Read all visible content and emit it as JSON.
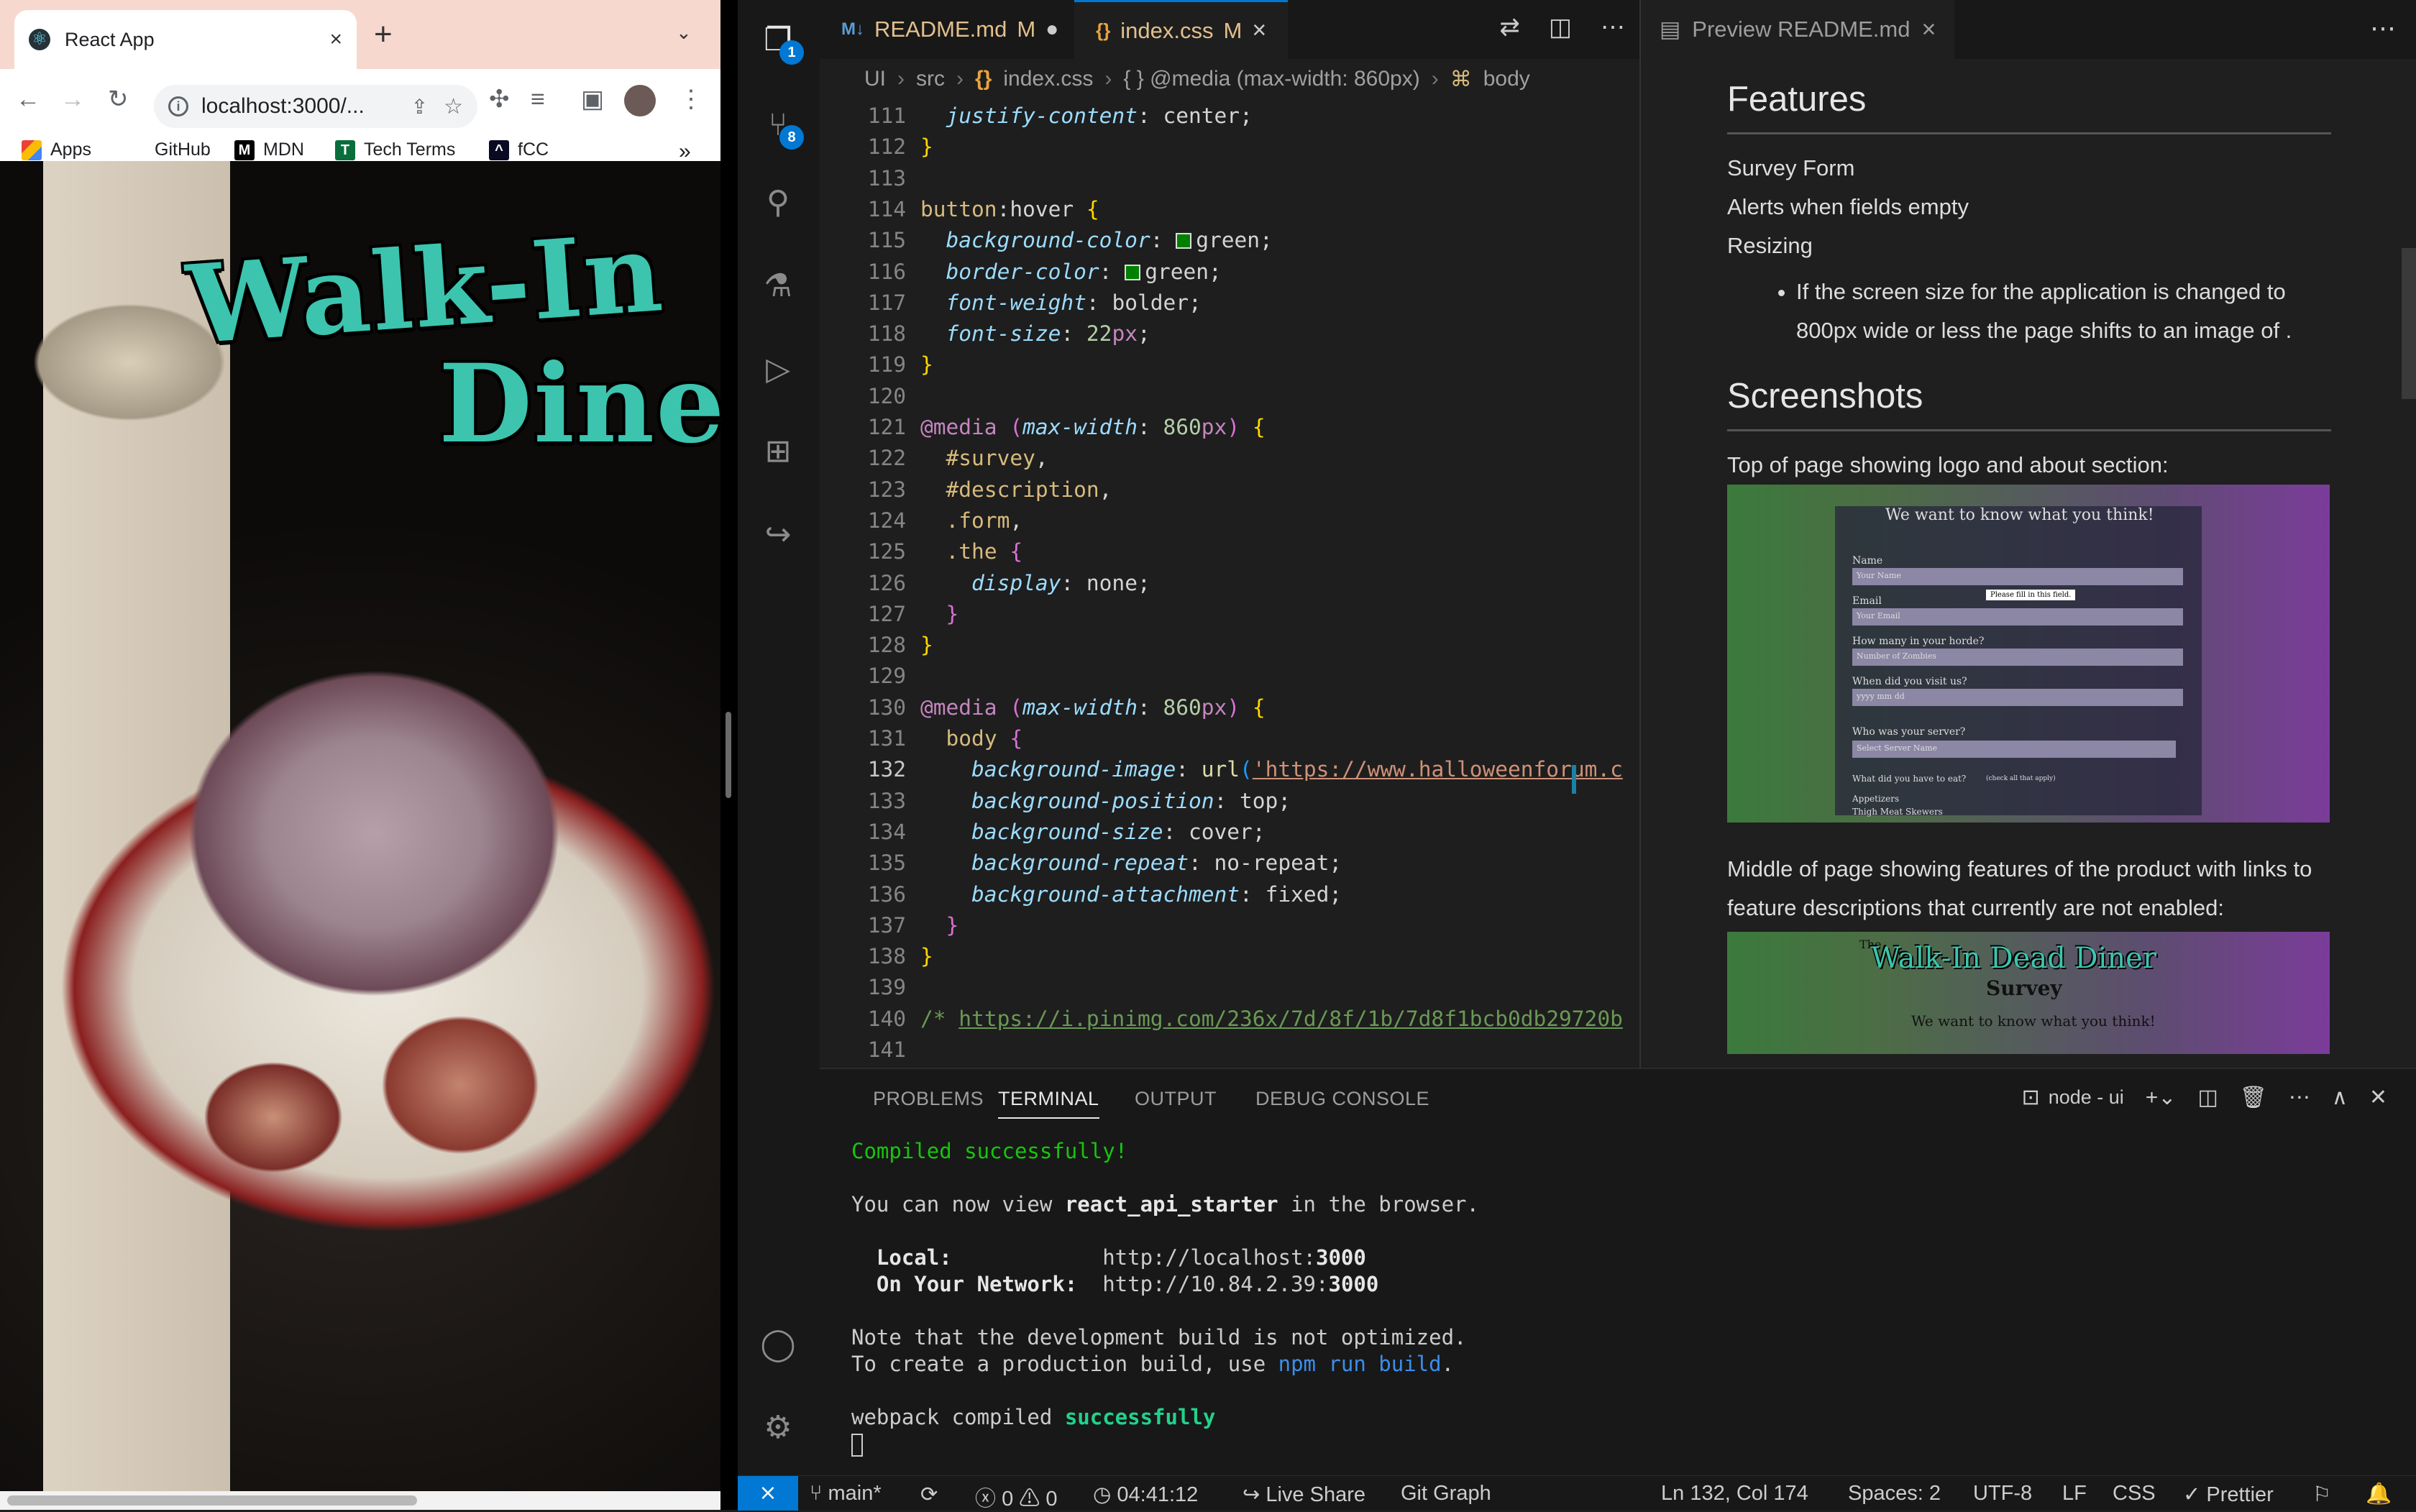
{
  "browser": {
    "tab_title": "React App",
    "tab_close": "×",
    "new_tab": "+",
    "url": "localhost:3000/...",
    "bookmarks": [
      {
        "label": "Apps",
        "icon": "apps-grid-icon"
      },
      {
        "label": "GitHub",
        "icon": "github-icon"
      },
      {
        "label": "MDN",
        "icon": "mdn-icon"
      },
      {
        "label": "Tech Terms",
        "icon": "techterms-icon"
      },
      {
        "label": "fCC",
        "icon": "fcc-icon"
      }
    ],
    "bookmarks_overflow": "»",
    "page": {
      "title_line1": "Walk-In",
      "title_line2": "Diner"
    }
  },
  "editor": {
    "tabs": [
      {
        "label": "README.md",
        "status": "M",
        "dirty": "●"
      },
      {
        "label": "index.css",
        "status": "M",
        "close": "×"
      }
    ],
    "breadcrumb": [
      "UI",
      "src",
      "index.css",
      "{ } @media (max-width: 860px)",
      "body"
    ],
    "code_lines": [
      {
        "n": "111",
        "html": "  <span class='kw-prop'>justify-content</span>: <span class='kw-plain'>center</span>;"
      },
      {
        "n": "112",
        "html": "<span class='kw-br'>}</span>"
      },
      {
        "n": "113",
        "html": ""
      },
      {
        "n": "114",
        "html": "<span class='kw-sel'>button</span><span class='kw-plain'>:hover</span> <span class='kw-br'>{</span>"
      },
      {
        "n": "115",
        "html": "  <span class='kw-prop'>background-color</span>: <span class='swatch'></span><span class='kw-plain'>green</span>;"
      },
      {
        "n": "116",
        "html": "  <span class='kw-prop'>border-color</span>: <span class='swatch'></span><span class='kw-plain'>green</span>;"
      },
      {
        "n": "117",
        "html": "  <span class='kw-prop'>font-weight</span>: <span class='kw-plain'>bolder</span>;"
      },
      {
        "n": "118",
        "html": "  <span class='kw-prop'>font-size</span>: <span class='kw-num'>22</span><span class='kw-at'>px</span>;"
      },
      {
        "n": "119",
        "html": "<span class='kw-br'>}</span>"
      },
      {
        "n": "120",
        "html": ""
      },
      {
        "n": "121",
        "html": "<span class='kw-at'>@media</span> <span class='kw-br2'>(</span><span class='kw-prop'>max-width</span>: <span class='kw-num'>860</span><span class='kw-at'>px</span><span class='kw-br2'>)</span> <span class='kw-br'>{</span>"
      },
      {
        "n": "122",
        "html": "  <span class='kw-id'>#survey</span>,"
      },
      {
        "n": "123",
        "html": "  <span class='kw-id'>#description</span>,"
      },
      {
        "n": "124",
        "html": "  <span class='kw-id'>.form</span>,"
      },
      {
        "n": "125",
        "html": "  <span class='kw-id'>.the</span> <span class='kw-br2'>{</span>"
      },
      {
        "n": "126",
        "html": "    <span class='kw-prop'>display</span>: <span class='kw-plain'>none</span>;"
      },
      {
        "n": "127",
        "html": "  <span class='kw-br2'>}</span>"
      },
      {
        "n": "128",
        "html": "<span class='kw-br'>}</span>"
      },
      {
        "n": "129",
        "html": ""
      },
      {
        "n": "130",
        "html": "<span class='kw-at'>@media</span> <span class='kw-br2'>(</span><span class='kw-prop'>max-width</span>: <span class='kw-num'>860</span><span class='kw-at'>px</span><span class='kw-br2'>)</span> <span class='kw-br'>{</span>"
      },
      {
        "n": "131",
        "html": "  <span class='kw-sel'>body</span> <span class='kw-br2'>{</span>"
      },
      {
        "n": "132",
        "html": "    <span class='kw-prop'>background-image</span>: <span class='kw-fn'>url</span><span class='kw-br3'>(</span><span class='kw-str' style='text-decoration:underline'>'https://www.halloweenforum.c</span>"
      },
      {
        "n": "133",
        "html": "    <span class='kw-prop'>background-position</span>: <span class='kw-plain'>top</span>;"
      },
      {
        "n": "134",
        "html": "    <span class='kw-prop'>background-size</span>: <span class='kw-plain'>cover</span>;"
      },
      {
        "n": "135",
        "html": "    <span class='kw-prop'>background-repeat</span>: <span class='kw-plain'>no-repeat</span>;"
      },
      {
        "n": "136",
        "html": "    <span class='kw-prop'>background-attachment</span>: <span class='kw-plain'>fixed</span>;"
      },
      {
        "n": "137",
        "html": "  <span class='kw-br2'>}</span>"
      },
      {
        "n": "138",
        "html": "<span class='kw-br'>}</span>"
      },
      {
        "n": "139",
        "html": ""
      },
      {
        "n": "140",
        "html": "<span class='kw-cm'>/* <span style='text-decoration:underline'>https://i.pinimg.com/236x/7d/8f/1b/7d8f1bcb0db29720b</span></span>"
      },
      {
        "n": "141",
        "html": ""
      }
    ]
  },
  "preview": {
    "tab_label": "Preview README.md",
    "tab_close": "×",
    "features_heading": "Features",
    "features": [
      "Survey Form",
      "Alerts when fields empty",
      "Resizing"
    ],
    "resizing_note": "If the screen size for the application is changed to 800px wide or less the page shifts to an image of .",
    "screenshots_heading": "Screenshots",
    "shot1_caption": "Top of page showing logo and about section:",
    "shot1": {
      "heading": "We want to know what you think!",
      "fields": [
        "Name",
        "Email",
        "How many in your horde?",
        "When did you visit us?",
        "Who was your server?"
      ],
      "placeholders": [
        "Your Name",
        "Your Email",
        "Number of Zombies",
        "yyyy  mm  dd",
        "Select Server Name"
      ],
      "tooltip": "Please fill in this field.",
      "eat_label": "What did you have to eat?",
      "eat_hint": "(check all that apply)",
      "appetizers": "Appetizers",
      "first_item": "Thigh Meat Skewers"
    },
    "shot2_caption": "Middle of page showing features of the product with links to feature descriptions that currently are not enabled:",
    "shot2": {
      "title_small": "The",
      "title": "Walk-In Dead Diner",
      "subtitle": "Survey",
      "tagline": "We want to know what you think!"
    }
  },
  "panel": {
    "tabs": [
      "PROBLEMS",
      "TERMINAL",
      "OUTPUT",
      "DEBUG CONSOLE"
    ],
    "active_tab": "TERMINAL",
    "terminal_name": "node - ui",
    "lines": {
      "compiled": "Compiled successfully!",
      "view_pre": "You can now view ",
      "app_name": "react_api_starter",
      "view_post": " in the browser.",
      "local_label": "  Local:",
      "local_url_pre": "            http://localhost:",
      "local_port": "3000",
      "network_label": "  On Your Network:",
      "network_url_pre": "  http://10.84.2.39:",
      "network_port": "3000",
      "note1": "Note that the development build is not optimized.",
      "note2_pre": "To create a production build, use ",
      "note2_cmd": "npm run build",
      "note2_post": ".",
      "webpack_pre": "webpack compiled ",
      "webpack_ok": "successfully"
    }
  },
  "status": {
    "remote": "⨯",
    "branch": "main*",
    "errors": "0",
    "warnings": "0",
    "time": "04:41:12",
    "live_share": "Live Share",
    "git_graph": "Git Graph",
    "cursor": "Ln 132, Col 174",
    "spaces": "Spaces: 2",
    "encoding": "UTF-8",
    "eol": "LF",
    "language": "CSS",
    "prettier": "✓ Prettier"
  },
  "activity_badges": {
    "explorer": "1",
    "scm": "8"
  },
  "colors": {
    "accent": "#0078d4",
    "brand_teal": "#3cc4ae",
    "success": "#23d18b"
  }
}
